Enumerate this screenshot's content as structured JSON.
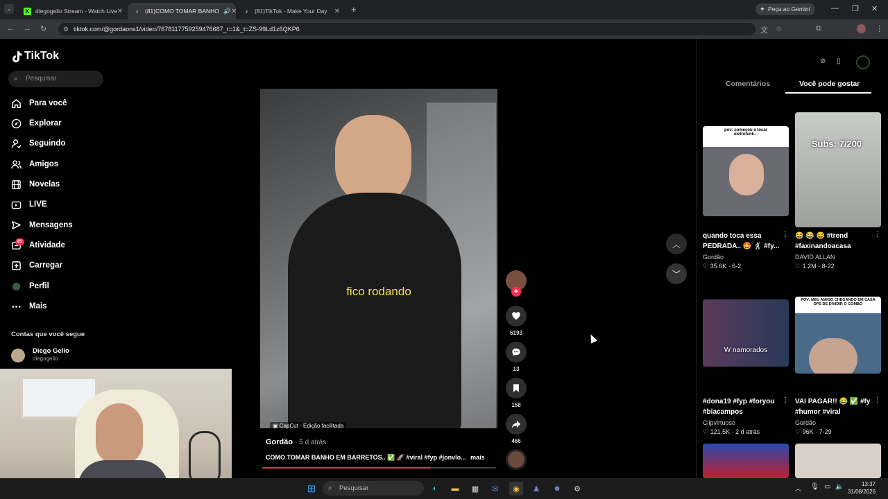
{
  "browser": {
    "tabs": [
      {
        "title": "diegogelio Stream - Watch Live"
      },
      {
        "title": "(81)COMO TOMAR BANHO"
      },
      {
        "title": "(81)TikTok - Make Your Day"
      }
    ],
    "gemini_label": "Peça ao Gemini",
    "url": "tiktok.com/@gordaons1/video/7678117759259476687_r=1&_t=ZS-99Ld1z6QKP6"
  },
  "sidebar": {
    "logo": "TikTok",
    "search_placeholder": "Pesquisar",
    "items": [
      {
        "label": "Para você",
        "icon": "home-icon"
      },
      {
        "label": "Explorar",
        "icon": "compass-icon"
      },
      {
        "label": "Seguindo",
        "icon": "user-follow-icon"
      },
      {
        "label": "Amigos",
        "icon": "friends-icon"
      },
      {
        "label": "Novelas",
        "icon": "film-icon"
      },
      {
        "label": "LIVE",
        "icon": "live-icon"
      },
      {
        "label": "Mensagens",
        "icon": "message-icon"
      },
      {
        "label": "Atividade",
        "icon": "activity-icon"
      },
      {
        "label": "Carregar",
        "icon": "upload-icon"
      },
      {
        "label": "Perfil",
        "icon": "profile-icon"
      },
      {
        "label": "Mais",
        "icon": "more-icon"
      }
    ],
    "activity_badge": "81",
    "following_title": "Contas que você segue",
    "account": {
      "name": "Diego Gelio",
      "handle": "diegogelio"
    }
  },
  "video": {
    "caption": "fico rodando",
    "capcut": "CapCut · Edição facilitada",
    "author": "Gordão",
    "time": "· 5 d atrás",
    "description": "COMO TOMAR BANHO EM BARRETOS.. ✅ 🚀 #viral #fyp #jonvlo...",
    "more": "mais",
    "progress": 0.72,
    "likes": "6193",
    "comments": "13",
    "saves": "158",
    "shares": "466"
  },
  "right_panel": {
    "tab_comments": "Comentários",
    "tab_suggest": "Você pode gostar",
    "cards": [
      {
        "thumb_text": "pov: começou a tocar eletrofunk...",
        "title": "quando toca essa PEDRADA.. 🤩 🕺 #fy...",
        "author": "Gordão",
        "likes": "35.6K",
        "date": "6-2"
      },
      {
        "thumb_text": "Subs: 7/200",
        "title": "😂 😂 😂 #trend #faxinandoacasa",
        "author": "DAVID ALLAN",
        "likes": "1.2M",
        "date": "8-22"
      },
      {
        "thumb_text": "W namorados",
        "title": "#dona19 #fyp #foryou #biacampos",
        "author": "Clipvirtuoso",
        "likes": "121.5K",
        "date": "2 d atrás"
      },
      {
        "thumb_text": "POV: MEU AMIGO CHEGANDO EM CASA DPS DE DIVIDIR O COMBO",
        "title": "VAI PAGAR!! 😂 ✅ #fy #humor #viral",
        "author": "Gordão",
        "likes": "96K",
        "date": "7-29"
      }
    ]
  },
  "taskbar": {
    "search_placeholder": "Pesquisar",
    "time": "13:37",
    "date": "31/08/2026"
  },
  "colors": {
    "accent": "#fe2c55",
    "caption": "#f5e34a"
  }
}
